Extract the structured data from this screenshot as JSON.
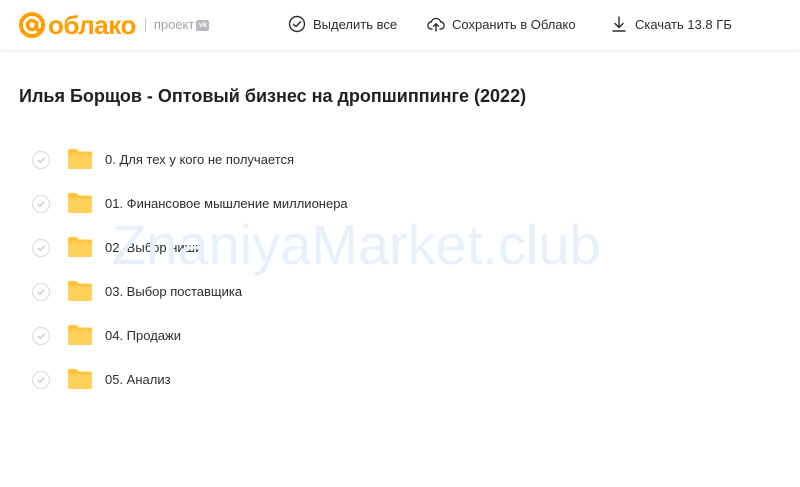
{
  "header": {
    "logo_text": "облако",
    "logo_project": "проект",
    "vk_badge": "vk",
    "select_all": "Выделить все",
    "save_to_cloud": "Сохранить в Облако",
    "download": "Скачать 13.8 ГБ"
  },
  "folder_title": "Илья Борщов - Оптовый бизнес на дропшиппинге (2022)",
  "items": [
    {
      "name": "0. Для тех у кого не получается"
    },
    {
      "name": "01. Финансовое мышление миллионера"
    },
    {
      "name": "02. Выбор ниши"
    },
    {
      "name": "03. Выбор поставщика"
    },
    {
      "name": "04. Продажи"
    },
    {
      "name": "05. Анализ"
    }
  ],
  "watermark": "ZnaniyaMarket.club",
  "colors": {
    "brand": "#ff9e00",
    "folder": "#ffc542",
    "watermark": "#e8f0fc"
  }
}
